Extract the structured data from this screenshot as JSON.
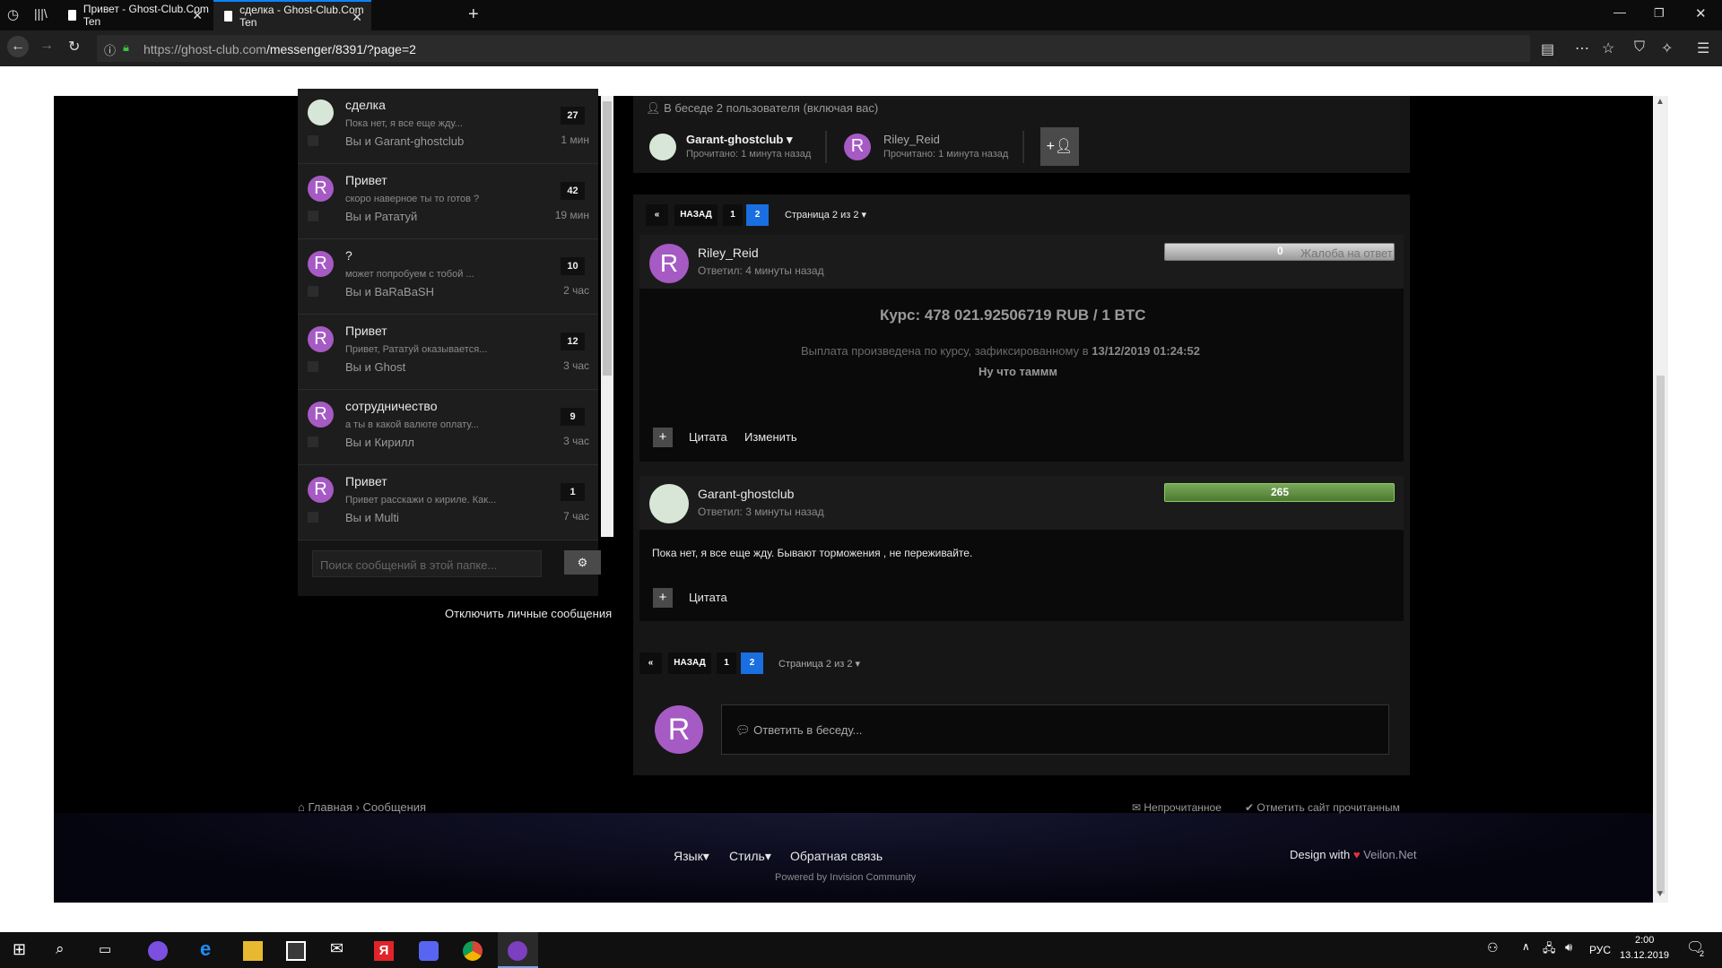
{
  "browser": {
    "tabs": [
      {
        "label": "Привет - Ghost-Club.Com Ten"
      },
      {
        "label": "сделка - Ghost-Club.Com Ten"
      }
    ],
    "url_host": "https://ghost-club.com",
    "url_path": "/messenger/8391/?page=2"
  },
  "sidebar": {
    "conversations": [
      {
        "title": "сделка",
        "snippet": "Пока нет, я все  еще жду...",
        "with": "Вы и Garant-ghostclub",
        "count": "27",
        "time": "1 мин",
        "avatar": "ghost"
      },
      {
        "title": "Привет",
        "snippet": "скоро наверное ты то готов ?",
        "with": "Вы и Рататуй",
        "count": "42",
        "time": "19 мин",
        "avatar": "R"
      },
      {
        "title": "?",
        "snippet": "может попробуем с тобой ...",
        "with": "Вы и BaRaBaSH",
        "count": "10",
        "time": "2 час",
        "avatar": "R"
      },
      {
        "title": "Привет",
        "snippet": "Привет, Рататуй оказывается...",
        "with": "Вы и Ghost",
        "count": "12",
        "time": "3 час",
        "avatar": "R"
      },
      {
        "title": "сотрудничество",
        "snippet": "а ты в какой валюте оплату...",
        "with": "Вы и Кирилл",
        "count": "9",
        "time": "3 час",
        "avatar": "R"
      },
      {
        "title": "Привет",
        "snippet": "Привет расскажи о кириле. Как...",
        "with": "Вы и Multi",
        "count": "1",
        "time": "7 час",
        "avatar": "R"
      }
    ],
    "search_placeholder": "Поиск сообщений в этой папке...",
    "disable_pm": "Отключить личные сообщения"
  },
  "conversation": {
    "participants_header": "В беседе 2 пользователя (включая вас)",
    "participants": [
      {
        "name": "Garant-ghostclub",
        "read": "Прочитано: 1 минута назад"
      },
      {
        "name": "Riley_Reid",
        "read": "Прочитано: 1 минута назад"
      }
    ],
    "add_icon": "add-user-icon"
  },
  "pagination": {
    "first": "«",
    "back": "НАЗАД",
    "pages": [
      "1",
      "2"
    ],
    "current": "2",
    "page_of": "Страница 2 из 2"
  },
  "messages": [
    {
      "author": "Riley_Reid",
      "replied": "Ответил: 4 минуты назад",
      "rep": "0",
      "report": "Жалоба на ответ",
      "rate": "Курс: 478 021.92506719 RUB / 1 BTC",
      "payout_prefix": "Выплата произведена по курсу, зафиксированному в",
      "payout_date": "13/12/2019 01:24:52",
      "body": "Ну что таммм",
      "actions": [
        "Цитата",
        "Изменить"
      ]
    },
    {
      "author": "Garant-ghostclub",
      "replied": "Ответил: 3 минуты назад",
      "rep": "265",
      "body": "Пока нет, я все  еще жду. Бывают торможения , не переживайте.",
      "actions": [
        "Цитата"
      ]
    }
  ],
  "reply": {
    "placeholder": "Ответить в беседу..."
  },
  "footer": {
    "breadcrumb_home": "Главная",
    "breadcrumb_current": "Сообщения",
    "unread": "Непрочитанное",
    "mark_read": "Отметить сайт прочитанным",
    "language": "Язык",
    "style": "Стиль",
    "feedback": "Обратная связь",
    "powered": "Powered by Invision Community",
    "design_prefix": "Design with",
    "design_brand": "Veilon.Net"
  },
  "taskbar": {
    "language": "РУС",
    "time": "2:00",
    "date": "13.12.2019",
    "notifications": "2"
  },
  "colors": {
    "accent": "#1a6fe0",
    "avatar_purple": "#a65ac4",
    "heart": "#e0343a",
    "rep_positive": "#5a8a3a"
  }
}
